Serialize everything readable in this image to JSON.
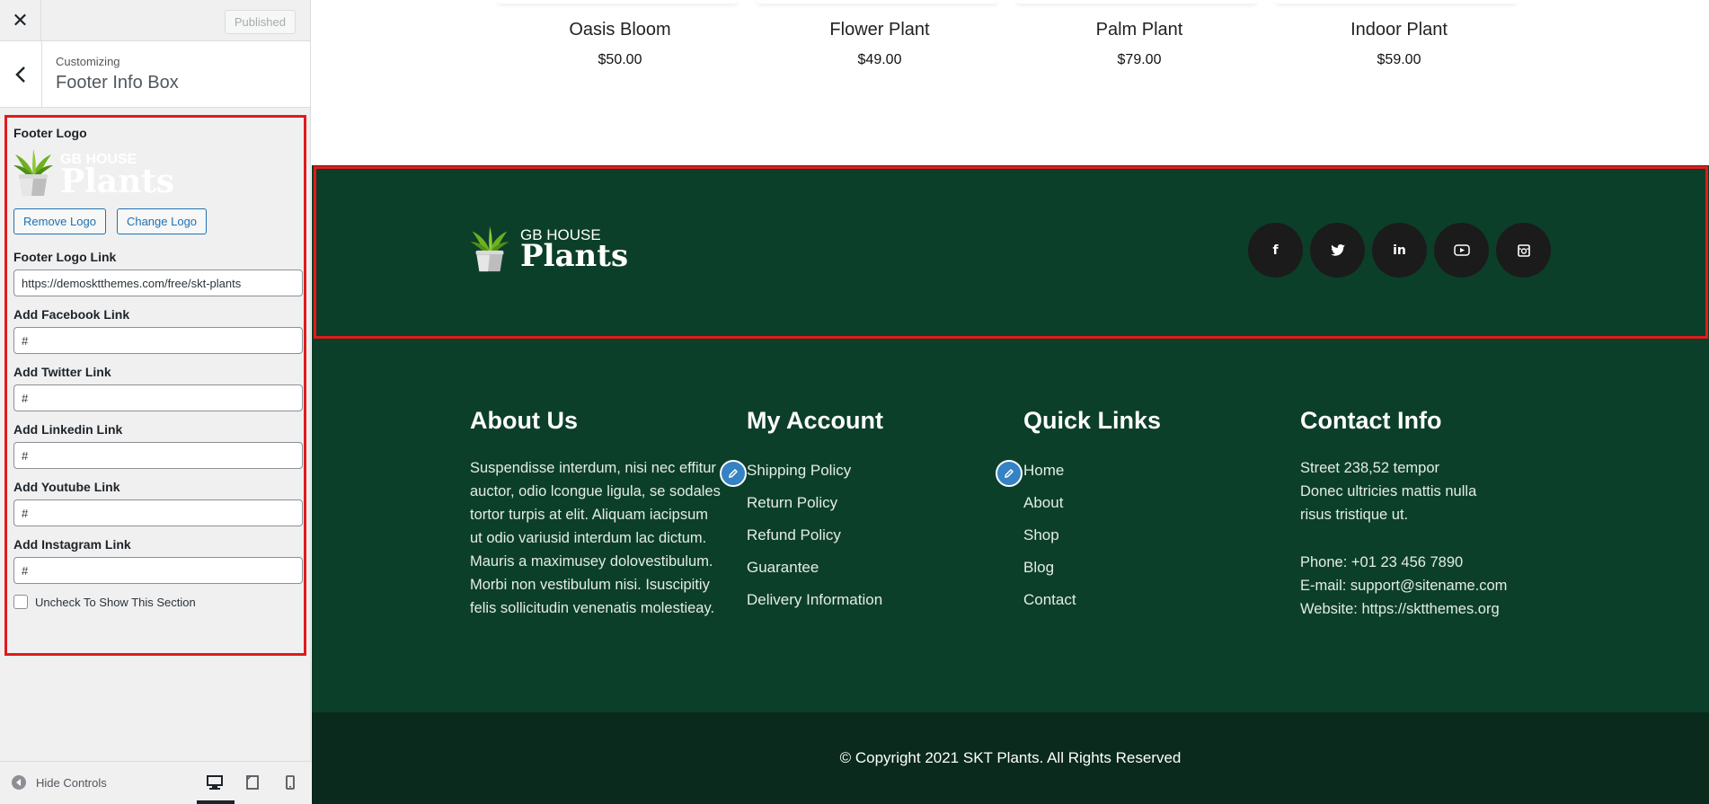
{
  "sidebar": {
    "close_icon": "close-icon",
    "published_label": "Published",
    "back_icon": "chevron-left-icon",
    "customizing_label": "Customizing",
    "section_title": "Footer Info Box",
    "footer_logo_label": "Footer Logo",
    "logo_text_small": "GB HOUSE",
    "logo_text_big": "Plants",
    "remove_logo_label": "Remove Logo",
    "change_logo_label": "Change Logo",
    "fields": [
      {
        "label": "Footer Logo Link",
        "value": "https://demosktthemes.com/free/skt-plants"
      },
      {
        "label": "Add Facebook Link",
        "value": "#"
      },
      {
        "label": "Add Twitter Link",
        "value": "#"
      },
      {
        "label": "Add Linkedin Link",
        "value": "#"
      },
      {
        "label": "Add Youtube Link",
        "value": "#"
      },
      {
        "label": "Add Instagram Link",
        "value": "#"
      }
    ],
    "hide_section_label": "Uncheck To Show This Section",
    "hide_controls_label": "Hide Controls"
  },
  "products": [
    {
      "name": "Oasis Bloom",
      "price": "$50.00"
    },
    {
      "name": "Flower Plant",
      "price": "$49.00"
    },
    {
      "name": "Palm Plant",
      "price": "$79.00"
    },
    {
      "name": "Indoor Plant",
      "price": "$59.00"
    }
  ],
  "footer": {
    "logo_small": "GB HOUSE",
    "logo_big": "Plants",
    "social": [
      {
        "name": "facebook-icon",
        "glyph": "f"
      },
      {
        "name": "twitter-icon",
        "glyph": "t"
      },
      {
        "name": "linkedin-icon",
        "glyph": "in"
      },
      {
        "name": "youtube-icon",
        "glyph": "▶"
      },
      {
        "name": "instagram-icon",
        "glyph": "◘"
      }
    ],
    "about": {
      "title": "About Us",
      "text": "Suspendisse interdum, nisi nec effitur auctor, odio lcongue ligula, se sodales tortor turpis at elit. Aliquam iacipsum ut odio variusid interdum lac dictum. Mauris a maximusey dolovestibulum. Morbi non vestibulum nisi. Isuscipitiy felis sollicitudin venenatis molestieay."
    },
    "account": {
      "title": "My Account",
      "links": [
        "Shipping Policy",
        "Return Policy",
        "Refund Policy",
        "Guarantee",
        "Delivery Information"
      ]
    },
    "quick": {
      "title": "Quick Links",
      "links": [
        "Home",
        "About",
        "Shop",
        "Blog",
        "Contact"
      ]
    },
    "contact": {
      "title": "Contact Info",
      "address_1": "Street 238,52 tempor",
      "address_2": "Donec ultricies mattis nulla",
      "address_3": "risus tristique ut.",
      "phone": "Phone: +01 23 456 7890",
      "email": "E-mail: support@sitename.com",
      "website": "Website: https://sktthemes.org"
    },
    "copyright": "© Copyright 2021 SKT Plants. All Rights Reserved"
  },
  "colors": {
    "footer_bg": "#0c3f29",
    "copyright_bg": "#092a1c",
    "highlight": "#e01b1b",
    "wp_blue": "#2271b1"
  }
}
